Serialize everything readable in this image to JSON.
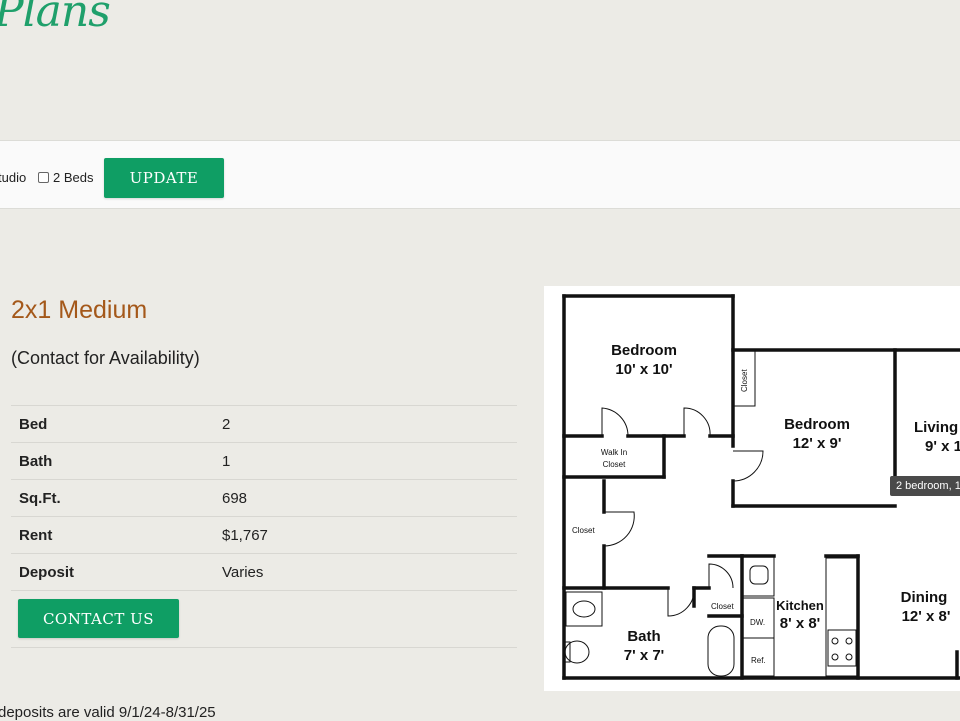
{
  "header": {
    "title": "Plans"
  },
  "filters": {
    "options": [
      {
        "label": "tudio",
        "checked": false
      },
      {
        "label": "2 Beds",
        "checked": false
      }
    ],
    "update_label": "UPDATE"
  },
  "plan": {
    "name": "2x1 Medium",
    "availability": "(Contact for Availability)",
    "specs": [
      {
        "label": "Bed",
        "value": "2"
      },
      {
        "label": "Bath",
        "value": "1"
      },
      {
        "label": "Sq.Ft.",
        "value": "698"
      },
      {
        "label": "Rent",
        "value": "$1,767"
      },
      {
        "label": "Deposit",
        "value": "Varies"
      }
    ],
    "contact_label": "CONTACT US"
  },
  "footnote": "deposits are valid 9/1/24-8/31/25",
  "floorplan": {
    "tooltip": "2 bedroom, 1",
    "rooms": [
      {
        "name": "Bedroom",
        "size": "10' x 10'"
      },
      {
        "name": "Bedroom",
        "size": "12' x 9'"
      },
      {
        "name": "Living",
        "size": "9' x 1"
      },
      {
        "name": "Bath",
        "size": "7' x 7'"
      },
      {
        "name": "Kitchen",
        "size": "8' x 8'"
      },
      {
        "name": "Dining",
        "size": "12' x 8'"
      }
    ],
    "labels": {
      "closet": "Closet",
      "walk_in_1": "Walk In",
      "walk_in_2": "Closet",
      "dw": "DW.",
      "ref": "Ref."
    }
  },
  "colors": {
    "accent": "#0f9e64",
    "heading": "#1fa06b",
    "plan_name": "#a4581a",
    "background": "#ecebe6"
  }
}
